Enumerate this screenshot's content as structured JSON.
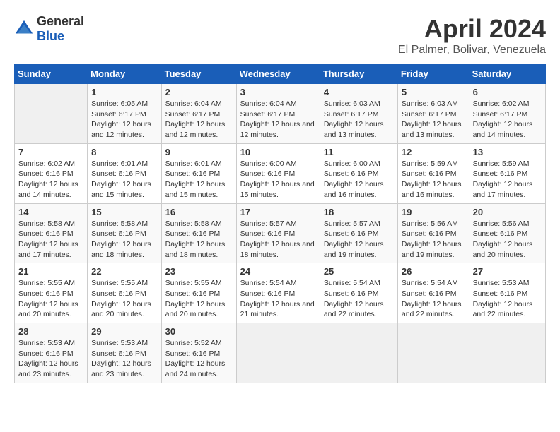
{
  "logo": {
    "general": "General",
    "blue": "Blue"
  },
  "title": "April 2024",
  "subtitle": "El Palmer, Bolivar, Venezuela",
  "weekdays": [
    "Sunday",
    "Monday",
    "Tuesday",
    "Wednesday",
    "Thursday",
    "Friday",
    "Saturday"
  ],
  "weeks": [
    [
      {
        "num": "",
        "sunrise": "",
        "sunset": "",
        "daylight": ""
      },
      {
        "num": "1",
        "sunrise": "Sunrise: 6:05 AM",
        "sunset": "Sunset: 6:17 PM",
        "daylight": "Daylight: 12 hours and 12 minutes."
      },
      {
        "num": "2",
        "sunrise": "Sunrise: 6:04 AM",
        "sunset": "Sunset: 6:17 PM",
        "daylight": "Daylight: 12 hours and 12 minutes."
      },
      {
        "num": "3",
        "sunrise": "Sunrise: 6:04 AM",
        "sunset": "Sunset: 6:17 PM",
        "daylight": "Daylight: 12 hours and 12 minutes."
      },
      {
        "num": "4",
        "sunrise": "Sunrise: 6:03 AM",
        "sunset": "Sunset: 6:17 PM",
        "daylight": "Daylight: 12 hours and 13 minutes."
      },
      {
        "num": "5",
        "sunrise": "Sunrise: 6:03 AM",
        "sunset": "Sunset: 6:17 PM",
        "daylight": "Daylight: 12 hours and 13 minutes."
      },
      {
        "num": "6",
        "sunrise": "Sunrise: 6:02 AM",
        "sunset": "Sunset: 6:17 PM",
        "daylight": "Daylight: 12 hours and 14 minutes."
      }
    ],
    [
      {
        "num": "7",
        "sunrise": "Sunrise: 6:02 AM",
        "sunset": "Sunset: 6:16 PM",
        "daylight": "Daylight: 12 hours and 14 minutes."
      },
      {
        "num": "8",
        "sunrise": "Sunrise: 6:01 AM",
        "sunset": "Sunset: 6:16 PM",
        "daylight": "Daylight: 12 hours and 15 minutes."
      },
      {
        "num": "9",
        "sunrise": "Sunrise: 6:01 AM",
        "sunset": "Sunset: 6:16 PM",
        "daylight": "Daylight: 12 hours and 15 minutes."
      },
      {
        "num": "10",
        "sunrise": "Sunrise: 6:00 AM",
        "sunset": "Sunset: 6:16 PM",
        "daylight": "Daylight: 12 hours and 15 minutes."
      },
      {
        "num": "11",
        "sunrise": "Sunrise: 6:00 AM",
        "sunset": "Sunset: 6:16 PM",
        "daylight": "Daylight: 12 hours and 16 minutes."
      },
      {
        "num": "12",
        "sunrise": "Sunrise: 5:59 AM",
        "sunset": "Sunset: 6:16 PM",
        "daylight": "Daylight: 12 hours and 16 minutes."
      },
      {
        "num": "13",
        "sunrise": "Sunrise: 5:59 AM",
        "sunset": "Sunset: 6:16 PM",
        "daylight": "Daylight: 12 hours and 17 minutes."
      }
    ],
    [
      {
        "num": "14",
        "sunrise": "Sunrise: 5:58 AM",
        "sunset": "Sunset: 6:16 PM",
        "daylight": "Daylight: 12 hours and 17 minutes."
      },
      {
        "num": "15",
        "sunrise": "Sunrise: 5:58 AM",
        "sunset": "Sunset: 6:16 PM",
        "daylight": "Daylight: 12 hours and 18 minutes."
      },
      {
        "num": "16",
        "sunrise": "Sunrise: 5:58 AM",
        "sunset": "Sunset: 6:16 PM",
        "daylight": "Daylight: 12 hours and 18 minutes."
      },
      {
        "num": "17",
        "sunrise": "Sunrise: 5:57 AM",
        "sunset": "Sunset: 6:16 PM",
        "daylight": "Daylight: 12 hours and 18 minutes."
      },
      {
        "num": "18",
        "sunrise": "Sunrise: 5:57 AM",
        "sunset": "Sunset: 6:16 PM",
        "daylight": "Daylight: 12 hours and 19 minutes."
      },
      {
        "num": "19",
        "sunrise": "Sunrise: 5:56 AM",
        "sunset": "Sunset: 6:16 PM",
        "daylight": "Daylight: 12 hours and 19 minutes."
      },
      {
        "num": "20",
        "sunrise": "Sunrise: 5:56 AM",
        "sunset": "Sunset: 6:16 PM",
        "daylight": "Daylight: 12 hours and 20 minutes."
      }
    ],
    [
      {
        "num": "21",
        "sunrise": "Sunrise: 5:55 AM",
        "sunset": "Sunset: 6:16 PM",
        "daylight": "Daylight: 12 hours and 20 minutes."
      },
      {
        "num": "22",
        "sunrise": "Sunrise: 5:55 AM",
        "sunset": "Sunset: 6:16 PM",
        "daylight": "Daylight: 12 hours and 20 minutes."
      },
      {
        "num": "23",
        "sunrise": "Sunrise: 5:55 AM",
        "sunset": "Sunset: 6:16 PM",
        "daylight": "Daylight: 12 hours and 20 minutes."
      },
      {
        "num": "24",
        "sunrise": "Sunrise: 5:54 AM",
        "sunset": "Sunset: 6:16 PM",
        "daylight": "Daylight: 12 hours and 21 minutes."
      },
      {
        "num": "25",
        "sunrise": "Sunrise: 5:54 AM",
        "sunset": "Sunset: 6:16 PM",
        "daylight": "Daylight: 12 hours and 22 minutes."
      },
      {
        "num": "26",
        "sunrise": "Sunrise: 5:54 AM",
        "sunset": "Sunset: 6:16 PM",
        "daylight": "Daylight: 12 hours and 22 minutes."
      },
      {
        "num": "27",
        "sunrise": "Sunrise: 5:53 AM",
        "sunset": "Sunset: 6:16 PM",
        "daylight": "Daylight: 12 hours and 22 minutes."
      }
    ],
    [
      {
        "num": "28",
        "sunrise": "Sunrise: 5:53 AM",
        "sunset": "Sunset: 6:16 PM",
        "daylight": "Daylight: 12 hours and 23 minutes."
      },
      {
        "num": "29",
        "sunrise": "Sunrise: 5:53 AM",
        "sunset": "Sunset: 6:16 PM",
        "daylight": "Daylight: 12 hours and 23 minutes."
      },
      {
        "num": "30",
        "sunrise": "Sunrise: 5:52 AM",
        "sunset": "Sunset: 6:16 PM",
        "daylight": "Daylight: 12 hours and 24 minutes."
      },
      {
        "num": "",
        "sunrise": "",
        "sunset": "",
        "daylight": ""
      },
      {
        "num": "",
        "sunrise": "",
        "sunset": "",
        "daylight": ""
      },
      {
        "num": "",
        "sunrise": "",
        "sunset": "",
        "daylight": ""
      },
      {
        "num": "",
        "sunrise": "",
        "sunset": "",
        "daylight": ""
      }
    ]
  ]
}
